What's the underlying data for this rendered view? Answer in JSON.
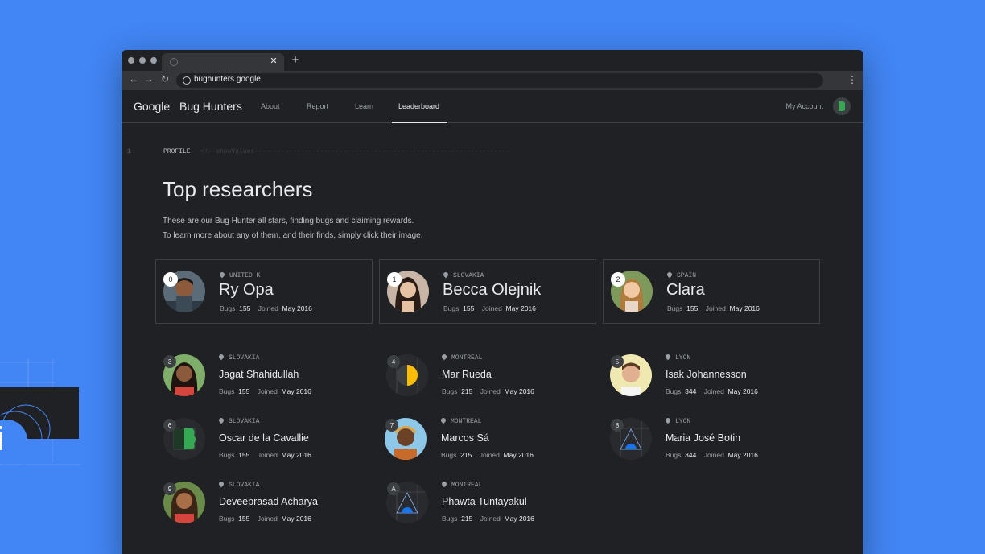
{
  "browser": {
    "url": "bughunters.google"
  },
  "header": {
    "google": "Google",
    "brand": "Bug Hunters",
    "nav": [
      "About",
      "Report",
      "Learn",
      "Leaderboard"
    ],
    "account": "My Account"
  },
  "code": {
    "line": "1",
    "label": "PROFILE",
    "comment": "<!--showValues------------------------------------------------------------------"
  },
  "page": {
    "title": "Top researchers",
    "desc1": "These are our Bug Hunter all stars, finding bugs and claiming rewards.",
    "desc2": "To learn more about any of them, and their finds, simply click their image."
  },
  "labels": {
    "bugs": "Bugs",
    "joined": "Joined"
  },
  "top": [
    {
      "rank": "0",
      "location": "UNITED K",
      "name": "Ry Opa",
      "bugs": "155",
      "joined": "May 2016"
    },
    {
      "rank": "1",
      "location": "SLOVAKIA",
      "name": "Becca Olejnik",
      "bugs": "155",
      "joined": "May 2016"
    },
    {
      "rank": "2",
      "location": "SPAIN",
      "name": "Clara",
      "bugs": "155",
      "joined": "May 2016"
    }
  ],
  "researchers": [
    {
      "rank": "3",
      "location": "SLOVAKIA",
      "name": "Jagat Shahidullah",
      "bugs": "155",
      "joined": "May 2016"
    },
    {
      "rank": "4",
      "location": "MONTREAL",
      "name": "Mar Rueda",
      "bugs": "215",
      "joined": "May 2016"
    },
    {
      "rank": "5",
      "location": "LYON",
      "name": "Isak Johannesson",
      "bugs": "344",
      "joined": "May 2016"
    },
    {
      "rank": "6",
      "location": "SLOVAKIA",
      "name": "Oscar de la Cavallie",
      "bugs": "155",
      "joined": "May 2016"
    },
    {
      "rank": "7",
      "location": "MONTREAL",
      "name": "Marcos Sá",
      "bugs": "215",
      "joined": "May 2016"
    },
    {
      "rank": "8",
      "location": "LYON",
      "name": "Maria José Botin",
      "bugs": "344",
      "joined": "May 2016"
    },
    {
      "rank": "9",
      "location": "SLOVAKIA",
      "name": "Deveeprasad Acharya",
      "bugs": "155",
      "joined": "May 2016"
    },
    {
      "rank": "A",
      "location": "MONTREAL",
      "name": "Phawta Tuntayakul",
      "bugs": "215",
      "joined": "May 2016"
    }
  ],
  "colors": {
    "background": "#4285f4",
    "window": "#202124",
    "accent_green": "#34a853",
    "accent_yellow": "#fbbc04",
    "accent_blue": "#1a73e8"
  }
}
